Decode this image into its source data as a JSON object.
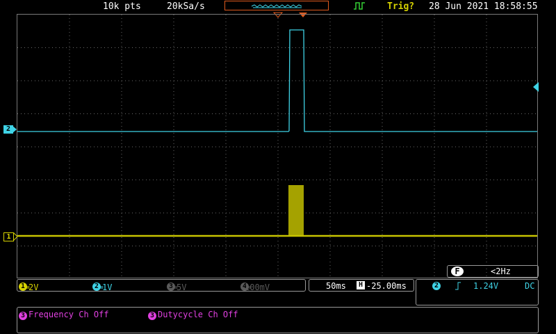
{
  "topbar": {
    "record_length": "10k pts",
    "sample_rate": "20kSa/s",
    "trigger_status": "Trig?",
    "datetime": "28 Jun 2021 18:58:55"
  },
  "channels": {
    "ch1": {
      "marker": "1",
      "color": "#d6d200",
      "scale": "2V"
    },
    "ch2": {
      "marker": "2",
      "color": "#3fd3e6",
      "scale": "1V"
    },
    "ch3": {
      "marker": "3",
      "color": "#5a5a5a",
      "scale": "5V"
    },
    "ch4": {
      "marker": "4",
      "color": "#5a5a5a",
      "scale": "100mV"
    }
  },
  "timebase": {
    "scale": "50ms",
    "h_label": "H",
    "position": "-25.00ms"
  },
  "frequency": {
    "badge": "F",
    "value": "<2Hz"
  },
  "trigger": {
    "source": "2",
    "level": "1.24V",
    "coupling": "DC"
  },
  "measurements": {
    "item1": {
      "marker": "3",
      "text": "Frequency Ch Off"
    },
    "item2": {
      "marker": "3",
      "text": "Dutycycle Ch Off"
    },
    "color": "#e040e0"
  },
  "colors": {
    "grid": "#6a6a6a",
    "accent_orange": "#e05a1e",
    "trig_green": "#34d034"
  }
}
